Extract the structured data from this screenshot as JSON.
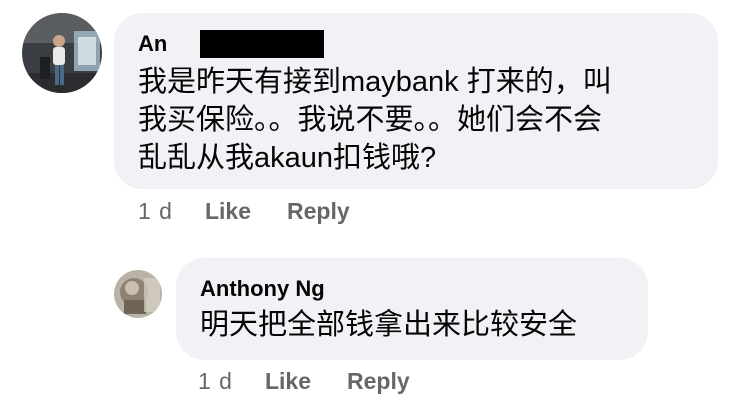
{
  "comments": [
    {
      "author": "An",
      "author_redacted": true,
      "text": "我是昨天有接到maybank 打来的，叫我买保险。。我说不要。。她们会不会乱乱从我akaun扣钱哦?",
      "text_lines": [
        "我是昨天有接到maybank 打来的，叫",
        "我买保险。。我说不要。。她们会不会",
        "乱乱从我akaun扣钱哦?"
      ],
      "time": "1 d",
      "like_label": "Like",
      "reply_label": "Reply"
    },
    {
      "author": "Anthony Ng",
      "text": "明天把全部钱拿出来比较安全",
      "time": "1 d",
      "like_label": "Like",
      "reply_label": "Reply"
    }
  ],
  "colors": {
    "bubble_bg": "#f0f2f5",
    "text": "#050505",
    "meta_text": "#65676b",
    "redaction": "#000000"
  },
  "icons": [
    "user-avatar-photo",
    "reply-user-avatar-photo"
  ]
}
